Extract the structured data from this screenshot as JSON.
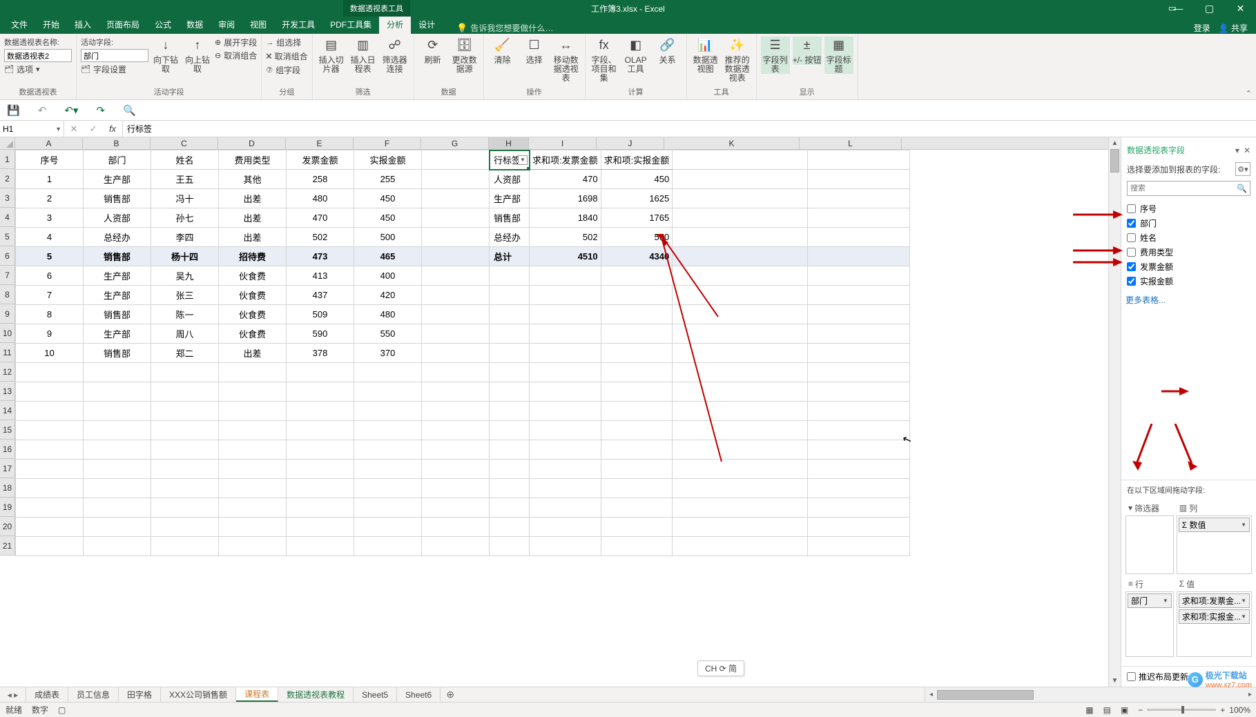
{
  "titlebar": {
    "contextTool": "数据透视表工具",
    "filename": "工作簿3.xlsx - Excel"
  },
  "ribbonRight": {
    "login": "登录",
    "share": "共享"
  },
  "tellme": "告诉我您想要做什么…",
  "tabs": {
    "file": "文件",
    "home": "开始",
    "insert": "插入",
    "layout": "页面布局",
    "formula": "公式",
    "data": "数据",
    "review": "审阅",
    "view": "视图",
    "dev": "开发工具",
    "pdf": "PDF工具集",
    "analyze": "分析",
    "design": "设计"
  },
  "ribbon": {
    "g1": {
      "nameLabel": "数据透视表名称:",
      "nameValue": "数据透视表2",
      "options": "选项",
      "groupLabel": "数据透视表"
    },
    "g2": {
      "activeLabel": "活动字段:",
      "activeValue": "部门",
      "fieldSettings": "字段设置",
      "drillDown": "向下钻取",
      "drillUp": "向上钻取",
      "expand": "展开字段",
      "collapse": "取消组合",
      "groupLabel": "活动字段"
    },
    "g3": {
      "groupSel": "组选择",
      "ungroup": "取消组合",
      "groupField": "组字段",
      "groupLabel": "分组"
    },
    "g4": {
      "slicer": "插入切片器",
      "timeline": "插入日程表",
      "filterConn": "筛选器连接",
      "groupLabel": "筛选"
    },
    "g5": {
      "refresh": "刷新",
      "changeSrc": "更改数据源",
      "groupLabel": "数据"
    },
    "g6": {
      "clear": "清除",
      "select": "选择",
      "move": "移动数据透视表",
      "groupLabel": "操作"
    },
    "g7": {
      "fields": "字段、项目和集",
      "olap": "OLAP 工具",
      "rel": "关系",
      "groupLabel": "计算"
    },
    "g8": {
      "chart": "数据透视图",
      "recommend": "推荐的数据透视表",
      "groupLabel": "工具"
    },
    "g9": {
      "fieldList": "字段列表",
      "plusMinus": "+/- 按钮",
      "fieldHeaders": "字段标题",
      "groupLabel": "显示"
    }
  },
  "namebox": "H1",
  "formula": "行标签",
  "columns": [
    "A",
    "B",
    "C",
    "D",
    "E",
    "F",
    "G",
    "H",
    "I",
    "J",
    "K",
    "L"
  ],
  "dataHeaders": {
    "a": "序号",
    "b": "部门",
    "c": "姓名",
    "d": "费用类型",
    "e": "发票金额",
    "f": "实报金额"
  },
  "dataRows": [
    {
      "a": "1",
      "b": "生产部",
      "c": "王五",
      "d": "其他",
      "e": "258",
      "f": "255"
    },
    {
      "a": "2",
      "b": "销售部",
      "c": "冯十",
      "d": "出差",
      "e": "480",
      "f": "450"
    },
    {
      "a": "3",
      "b": "人资部",
      "c": "孙七",
      "d": "出差",
      "e": "470",
      "f": "450"
    },
    {
      "a": "4",
      "b": "总经办",
      "c": "李四",
      "d": "出差",
      "e": "502",
      "f": "500"
    },
    {
      "a": "5",
      "b": "销售部",
      "c": "杨十四",
      "d": "招待费",
      "e": "473",
      "f": "465"
    },
    {
      "a": "6",
      "b": "生产部",
      "c": "吴九",
      "d": "伙食费",
      "e": "413",
      "f": "400"
    },
    {
      "a": "7",
      "b": "生产部",
      "c": "张三",
      "d": "伙食费",
      "e": "437",
      "f": "420"
    },
    {
      "a": "8",
      "b": "销售部",
      "c": "陈一",
      "d": "伙食费",
      "e": "509",
      "f": "480"
    },
    {
      "a": "9",
      "b": "生产部",
      "c": "周八",
      "d": "伙食费",
      "e": "590",
      "f": "550"
    },
    {
      "a": "10",
      "b": "销售部",
      "c": "郑二",
      "d": "出差",
      "e": "378",
      "f": "370"
    }
  ],
  "pivot": {
    "rowLabel": "行标签",
    "col1": "求和项:发票金额",
    "col2": "求和项:实报金额",
    "rows": [
      {
        "l": "人资部",
        "v1": "470",
        "v2": "450"
      },
      {
        "l": "生产部",
        "v1": "1698",
        "v2": "1625"
      },
      {
        "l": "销售部",
        "v1": "1840",
        "v2": "1765"
      },
      {
        "l": "总经办",
        "v1": "502",
        "v2": "500"
      }
    ],
    "total": {
      "l": "总计",
      "v1": "4510",
      "v2": "4340"
    }
  },
  "sheetTabs": {
    "t1": "成绩表",
    "t2": "员工信息",
    "t3": "田字格",
    "t4": "XXX公司销售额",
    "t5": "课程表",
    "t6": "数据透视表教程",
    "t7": "Sheet5",
    "t8": "Sheet6"
  },
  "status": {
    "ready": "就绪",
    "num": "数字",
    "zoom": "100%"
  },
  "chsBadge": "CH ⟳ 简",
  "fieldPane": {
    "title": "数据透视表字段",
    "sub": "选择要添加到报表的字段:",
    "searchPlaceholder": "搜索",
    "fields": [
      {
        "label": "序号",
        "checked": false
      },
      {
        "label": "部门",
        "checked": true
      },
      {
        "label": "姓名",
        "checked": false
      },
      {
        "label": "费用类型",
        "checked": false
      },
      {
        "label": "发票金额",
        "checked": true
      },
      {
        "label": "实报金额",
        "checked": true
      }
    ],
    "more": "更多表格...",
    "dragLabel": "在以下区域间拖动字段:",
    "areas": {
      "filter": "筛选器",
      "columns": "列",
      "rows": "行",
      "values": "值",
      "columnsChip": "Σ 数值",
      "rowsChip": "部门",
      "valuesChip1": "求和项:发票金...",
      "valuesChip2": "求和项:实报金..."
    },
    "defer": "推迟布局更新"
  },
  "watermark": {
    "brand": "极光下载站",
    "url": "www.xz7.com"
  }
}
